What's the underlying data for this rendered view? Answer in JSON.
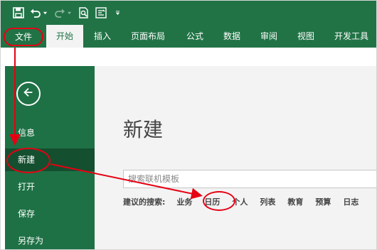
{
  "ribbon": {
    "tabs": [
      {
        "label": "文件"
      },
      {
        "label": "开始"
      },
      {
        "label": "插入"
      },
      {
        "label": "页面布局"
      },
      {
        "label": "公式"
      },
      {
        "label": "数据"
      },
      {
        "label": "审阅"
      },
      {
        "label": "视图"
      },
      {
        "label": "开发工具"
      }
    ],
    "active_tab_index": 1
  },
  "backstage": {
    "nav_items": [
      {
        "label": "信息"
      },
      {
        "label": "新建"
      },
      {
        "label": "打开"
      },
      {
        "label": "保存"
      },
      {
        "label": "另存为"
      }
    ],
    "active_item_index": 1
  },
  "main": {
    "title": "新建",
    "search_placeholder": "搜索联机模板",
    "suggested_label": "建议的搜索:",
    "suggested_keywords": [
      "业务",
      "日历",
      "个人",
      "列表",
      "教育",
      "预算",
      "日志"
    ]
  },
  "colors": {
    "excel_green": "#217346",
    "backstage_green": "#1e7145",
    "active_nav": "#144f30",
    "annotation_red": "#e60012"
  },
  "icons": {
    "qat": [
      "save-icon",
      "undo-icon",
      "redo-icon",
      "print-preview-icon",
      "touch-mode-icon",
      "customize-qat-icon"
    ],
    "back": "back-arrow-icon"
  }
}
